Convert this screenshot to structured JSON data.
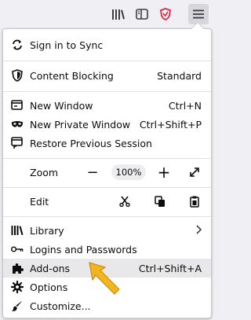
{
  "toolbar": {
    "icons": [
      "library-icon",
      "sidebar-icon",
      "brave-shield-icon",
      "hamburger-menu-icon"
    ]
  },
  "menu": {
    "sign_in": "Sign in to Sync",
    "content_blocking": {
      "label": "Content Blocking",
      "value": "Standard"
    },
    "new_window": {
      "label": "New Window",
      "shortcut": "Ctrl+N"
    },
    "new_private_window": {
      "label": "New Private Window",
      "shortcut": "Ctrl+Shift+P"
    },
    "restore_session": "Restore Previous Session",
    "zoom": {
      "label": "Zoom",
      "minus": "−",
      "value": "100%",
      "plus": "+"
    },
    "edit": {
      "label": "Edit"
    },
    "library": "Library",
    "logins": "Logins and Passwords",
    "addons": {
      "label": "Add-ons",
      "shortcut": "Ctrl+Shift+A"
    },
    "options": "Options",
    "customize": "Customize..."
  },
  "colors": {
    "highlight": "#e8e8ea",
    "arrow": "#f3b51f",
    "shield": "#e0244b"
  }
}
